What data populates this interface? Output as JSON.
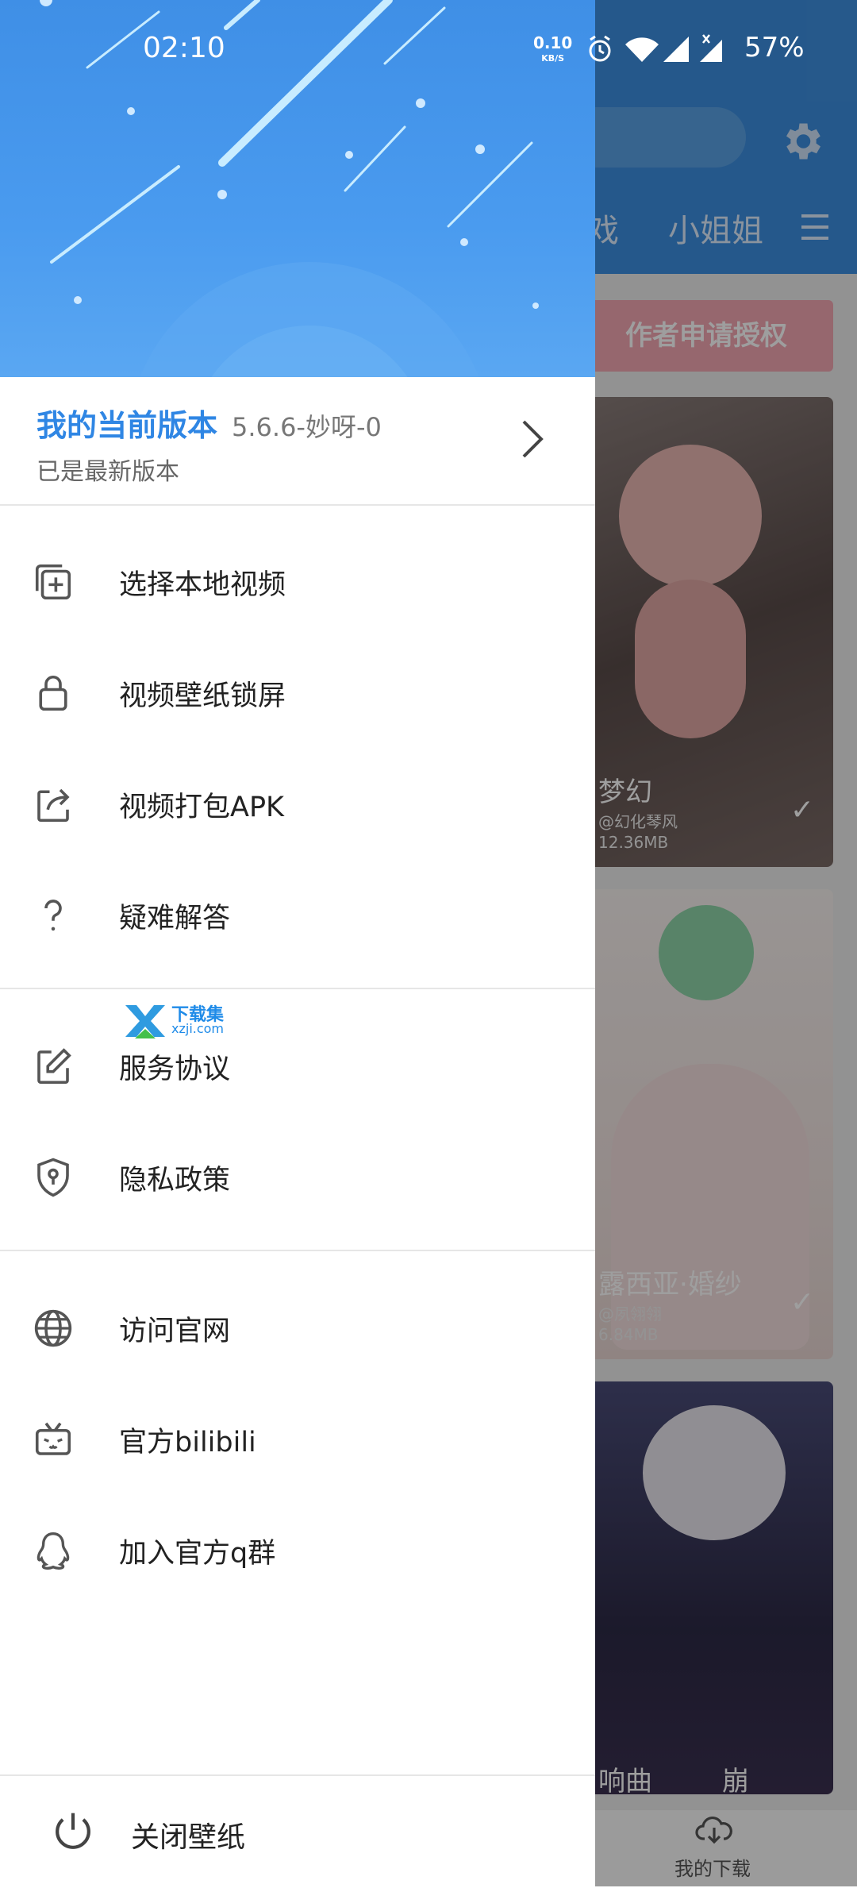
{
  "status_bar": {
    "time": "02:10",
    "net_speed": "0.10",
    "net_unit": "KB/S",
    "battery": "57%",
    "icons": [
      "alarm-icon",
      "wifi-icon",
      "signal-icon",
      "signal-x-icon"
    ]
  },
  "background": {
    "tabs": [
      "戏",
      "小姐姐"
    ],
    "banner": "作者申请授权",
    "cards": [
      {
        "title": "梦幻",
        "author": "@幻化琴风",
        "size": "12.36MB"
      },
      {
        "title": "露西亚·婚纱",
        "author": "@夙翎翎",
        "size": "6.84MB"
      },
      {
        "title": "响曲",
        "extra": "崩"
      }
    ],
    "bottom_tab": "我的下载"
  },
  "drawer": {
    "version_label": "我的当前版本",
    "version_number": "5.6.6-妙呀-0",
    "version_status": "已是最新版本",
    "menu_group1": [
      {
        "label": "选择本地视频",
        "icon": "add-copy-icon"
      },
      {
        "label": "视频壁纸锁屏",
        "icon": "lock-icon"
      },
      {
        "label": "视频打包APK",
        "icon": "share-icon"
      },
      {
        "label": "疑难解答",
        "icon": "question-icon"
      }
    ],
    "menu_group2": [
      {
        "label": "服务协议",
        "icon": "edit-icon"
      },
      {
        "label": "隐私政策",
        "icon": "shield-icon"
      }
    ],
    "menu_group3": [
      {
        "label": "访问官网",
        "icon": "globe-icon"
      },
      {
        "label": "官方bilibili",
        "icon": "bilibili-icon"
      },
      {
        "label": "加入官方q群",
        "icon": "qq-icon"
      }
    ],
    "close_label": "关闭壁纸"
  },
  "watermark": {
    "title": "下载集",
    "url": "xzji.com"
  }
}
